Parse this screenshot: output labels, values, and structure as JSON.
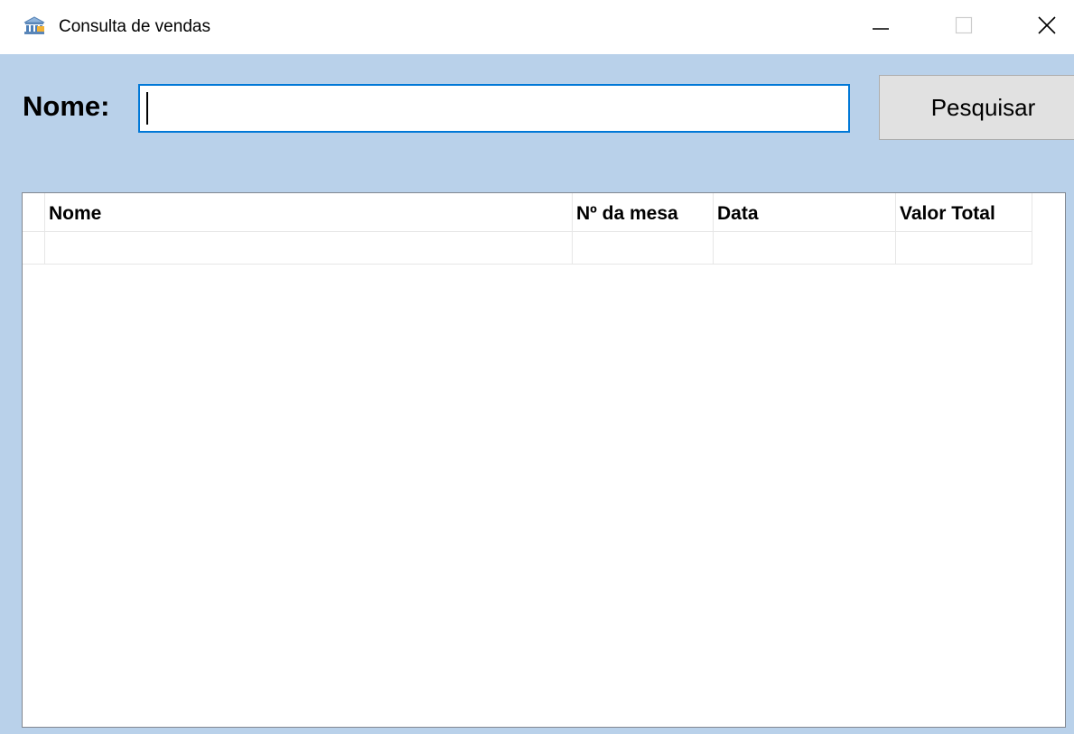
{
  "window": {
    "title": "Consulta de vendas",
    "icon": "bank-icon"
  },
  "controls": {
    "minimize": "minimize-icon",
    "maximize": "maximize-icon",
    "close": "close-icon"
  },
  "search": {
    "label": "Nome:",
    "value": "",
    "button_label": "Pesquisar"
  },
  "table": {
    "columns": [
      "Nome",
      "Nº da mesa",
      "Data",
      "Valor Total"
    ],
    "rows": [
      [
        "",
        "",
        "",
        ""
      ]
    ]
  },
  "colors": {
    "client_background": "#b9d1ea",
    "input_border_focus": "#0078d7",
    "button_background": "#e1e1e1"
  }
}
